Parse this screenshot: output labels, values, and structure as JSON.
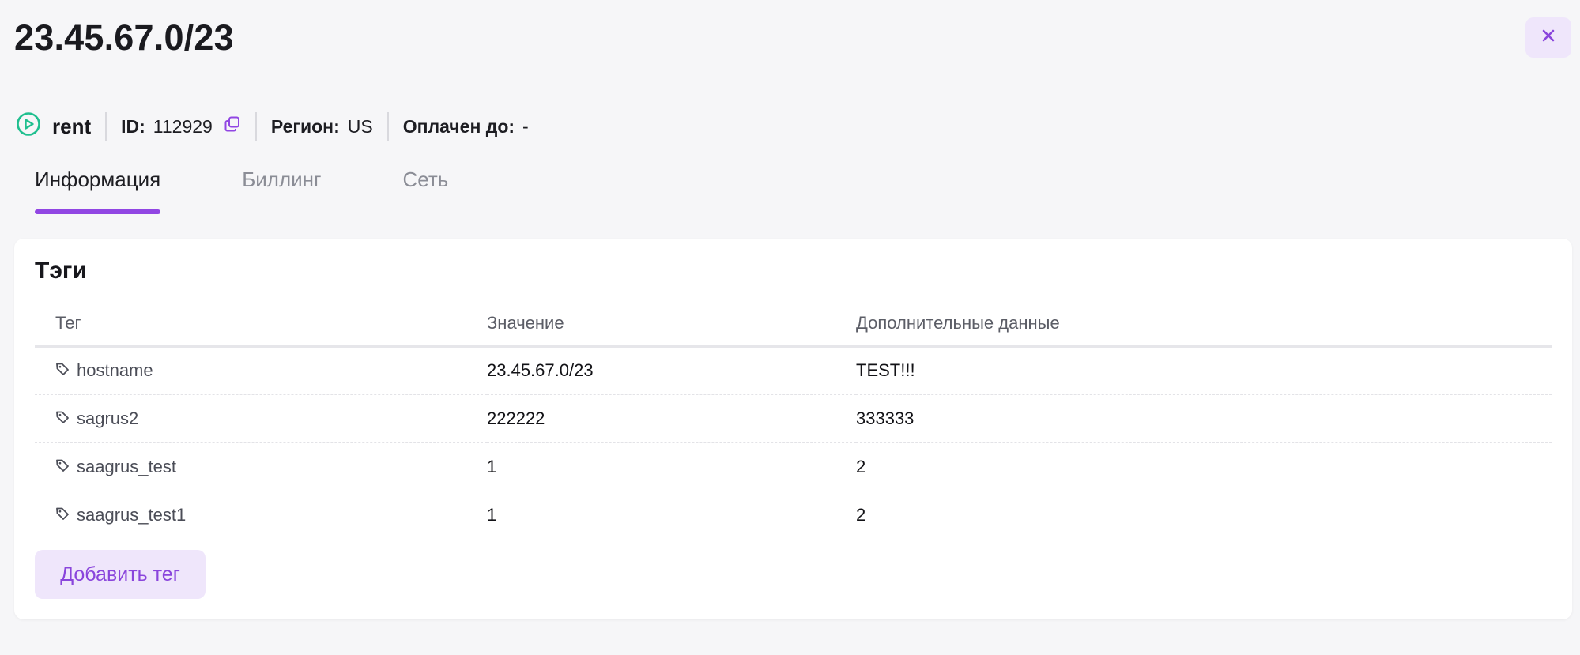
{
  "header": {
    "title": "23.45.67.0/23",
    "close_icon": "close-icon"
  },
  "meta": {
    "status_label": "rent",
    "status_icon": "play-circle-icon",
    "status_color": "#1fbf8f",
    "id_key": "ID:",
    "id_value": "112929",
    "copy_icon": "copy-icon",
    "region_key": "Регион:",
    "region_value": "US",
    "paid_key": "Оплачен до:",
    "paid_value": "-"
  },
  "tabs": [
    {
      "label": "Информация",
      "active": true
    },
    {
      "label": "Биллинг",
      "active": false
    },
    {
      "label": "Сеть",
      "active": false
    }
  ],
  "tags_section": {
    "title": "Тэги",
    "columns": [
      "Тег",
      "Значение",
      "Дополнительные данные"
    ],
    "rows": [
      {
        "tag": "hostname",
        "value": "23.45.67.0/23",
        "extra": "TEST!!!"
      },
      {
        "tag": "sagrus2",
        "value": "222222",
        "extra": "333333"
      },
      {
        "tag": "saagrus_test",
        "value": "1",
        "extra": "2"
      },
      {
        "tag": "saagrus_test1",
        "value": "1",
        "extra": "2"
      }
    ],
    "add_button_label": "Добавить тег"
  },
  "colors": {
    "accent": "#9146e3",
    "accent_soft": "#efe6fb",
    "background": "#f6f6f8"
  }
}
